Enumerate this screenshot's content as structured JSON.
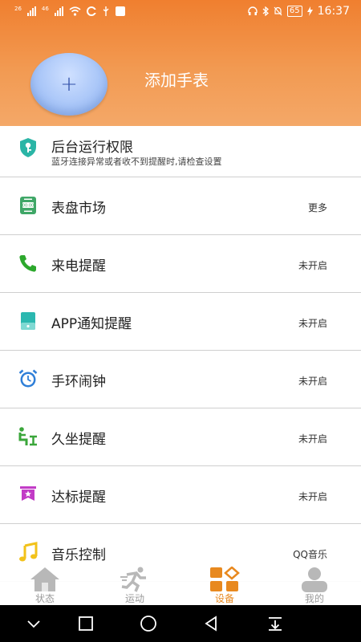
{
  "status_bar": {
    "network1": "26",
    "network2": "46",
    "battery": "65",
    "time": "16:37"
  },
  "header": {
    "add_watch_symbol": "+",
    "add_watch_label": "添加手表",
    "gradient_top": "#f07f2f",
    "gradient_bottom": "#f4a868"
  },
  "list": {
    "background_run": {
      "label": "后台运行权限",
      "sub": "蓝牙连接异常或者收不到提醒时,请检查设置",
      "icon": "shield-key-icon",
      "color": "#2bb5a6"
    },
    "items": [
      {
        "label": "表盘市场",
        "status": "更多",
        "icon": "watchface-icon",
        "color": "#3fa767"
      },
      {
        "label": "来电提醒",
        "status": "未开启",
        "icon": "phone-icon",
        "color": "#2ca82c"
      },
      {
        "label": "APP通知提醒",
        "status": "未开启",
        "icon": "tablet-icon",
        "color": "#2bb8b0"
      },
      {
        "label": "手环闹钟",
        "status": "未开启",
        "icon": "alarm-clock-icon",
        "color": "#2f7fd8"
      },
      {
        "label": "久坐提醒",
        "status": "未开启",
        "icon": "sitting-person-icon",
        "color": "#3aa63a"
      },
      {
        "label": "达标提醒",
        "status": "未开启",
        "icon": "goal-flag-icon",
        "color": "#c23bc6"
      },
      {
        "label": "音乐控制",
        "status": "QQ音乐",
        "icon": "music-note-icon",
        "color": "#f2c21a"
      }
    ]
  },
  "bottom_nav": {
    "tabs": [
      {
        "label": "状态",
        "icon": "home-icon"
      },
      {
        "label": "运动",
        "icon": "running-icon"
      },
      {
        "label": "设备",
        "icon": "devices-grid-icon",
        "active": true
      },
      {
        "label": "我的",
        "icon": "profile-icon"
      }
    ],
    "active_color": "#e8891f"
  }
}
